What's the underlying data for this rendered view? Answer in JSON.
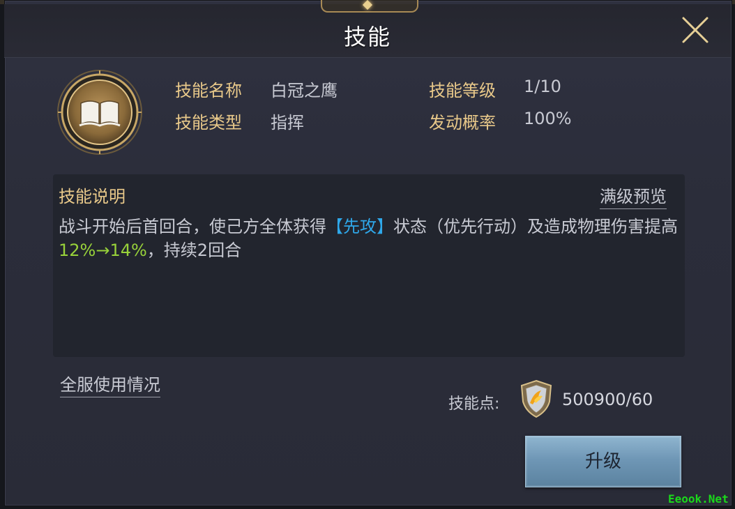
{
  "window": {
    "title": "技能"
  },
  "skill": {
    "name_label": "技能名称",
    "name_value": "白冠之鹰",
    "type_label": "技能类型",
    "type_value": "指挥",
    "level_label": "技能等级",
    "level_value": "1/10",
    "rate_label": "发动概率",
    "rate_value": "100%"
  },
  "description": {
    "title": "技能说明",
    "preview_link": "满级预览",
    "text_part1": "战斗开始后首回合，使己方全体获得",
    "keyword": "【先攻】",
    "text_part2": "状态（优先行动）及造成物理伤害提高",
    "value_change": "12%→14%",
    "text_part3": "，持续2回合"
  },
  "footer": {
    "server_usage_link": "全服使用情况",
    "points_label": "技能点:",
    "points_value": "500900/60",
    "upgrade_button": "升级"
  },
  "watermark": "Eeook.Net",
  "colors": {
    "gold_label": "#e9c98a",
    "keyword_blue": "#2fa8ea",
    "value_green": "#98d23a",
    "button_blue": "#6f97b6"
  }
}
